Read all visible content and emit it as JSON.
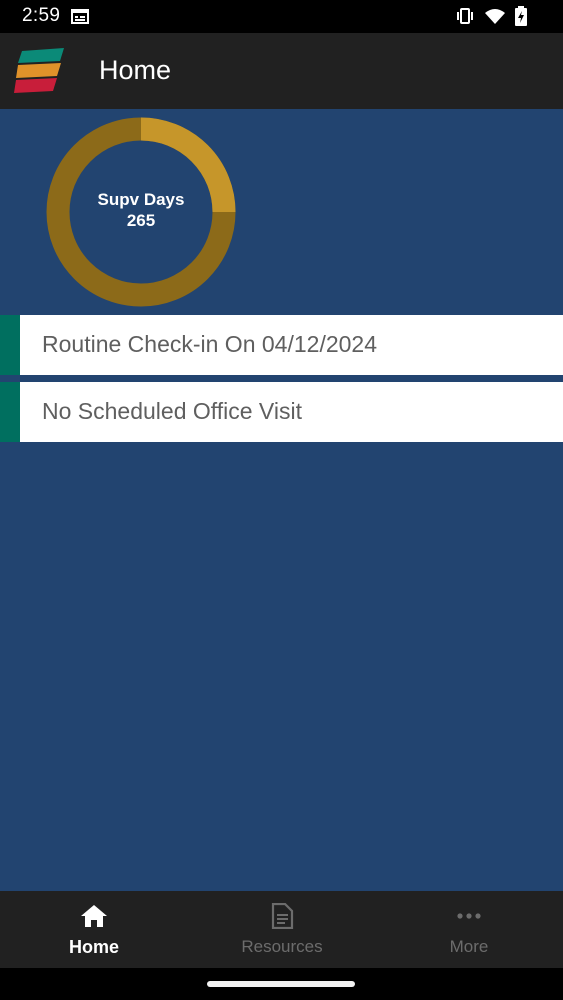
{
  "status_bar": {
    "time": "2:59",
    "icons": [
      "calendar-icon",
      "vibrate-icon",
      "wifi-icon",
      "battery-charging-icon"
    ]
  },
  "app_bar": {
    "title": "Home",
    "logo": "app-logo"
  },
  "supervision": {
    "label": "Supv Days",
    "value": "265",
    "progress_fraction": 0.25,
    "colors": {
      "progress": "#c6962a",
      "track": "#8c6a19"
    }
  },
  "cards": [
    {
      "text": "Routine Check-in On 04/12/2024"
    },
    {
      "text": "No Scheduled Office Visit"
    }
  ],
  "bottom_nav": {
    "items": [
      {
        "label": "Home",
        "icon": "home-icon",
        "selected": true
      },
      {
        "label": "Resources",
        "icon": "document-icon",
        "selected": false
      },
      {
        "label": "More",
        "icon": "more-dots-icon",
        "selected": false
      }
    ]
  },
  "colors": {
    "main_background": "#224470",
    "app_bar": "#212121",
    "card_accent": "#006f5f"
  }
}
